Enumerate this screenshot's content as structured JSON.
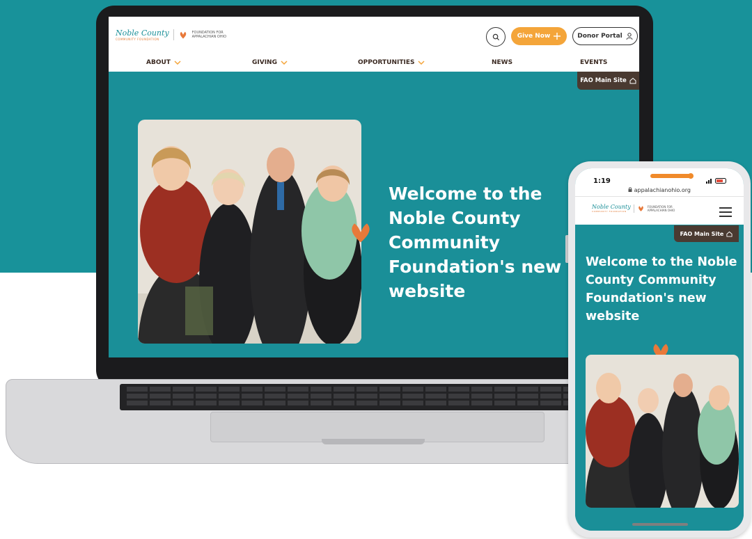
{
  "desktop": {
    "logo": {
      "brand": "Noble County",
      "sub": "COMMUNITY FOUNDATION",
      "partner": "FOUNDATION FOR APPALACHIAN OHIO"
    },
    "header": {
      "give_label": "Give Now",
      "donor_label": "Donor Portal"
    },
    "nav": [
      {
        "label": "ABOUT",
        "dropdown": true
      },
      {
        "label": "GIVING",
        "dropdown": true
      },
      {
        "label": "OPPORTUNITIES",
        "dropdown": true
      },
      {
        "label": "NEWS",
        "dropdown": false
      },
      {
        "label": "EVENTS",
        "dropdown": false
      }
    ],
    "fao_tab": "FAO Main Site",
    "hero_title": "Welcome to the Noble County Community Foundation's new website"
  },
  "phone": {
    "time": "1:19",
    "url": "appalachianohio.org",
    "fao_tab": "FAO Main Site",
    "hero_title": "Welcome to the Noble County Community Foundation's new website"
  },
  "colors": {
    "teal": "#18929a",
    "orange": "#f4a53a",
    "brown": "#4a3a31",
    "leaf": "#e8793a"
  },
  "icons": [
    "search-icon",
    "plus-icon",
    "user-icon",
    "chevron-down-icon",
    "home-icon",
    "menu-icon",
    "leaf-icon"
  ]
}
